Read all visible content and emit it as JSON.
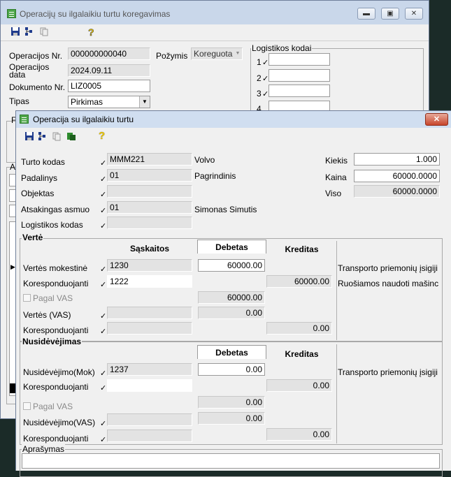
{
  "back": {
    "title": "Operacijų su ilgalaikiu turtu koregavimas",
    "op_nr_label": "Operacijos Nr.",
    "op_nr": "000000000040",
    "op_date_label": "Operacijos data",
    "op_date": "2024.09.11",
    "doc_nr_label": "Dokumento Nr.",
    "doc_nr": "LIZ0005",
    "type_label": "Tipas",
    "type_value": "Pirkimas",
    "pozymis_label": "Požymis",
    "pozymis_value": "Koreguota",
    "logistics_group": "Logistikos kodai",
    "logistics_rows": [
      "1",
      "2",
      "3",
      "4"
    ],
    "frag_f": "F",
    "frag_a": "A"
  },
  "front": {
    "title": "Operacija su ilgalaikiu turtu",
    "help_glyph": "?",
    "asset_code_label": "Turto kodas",
    "asset_code": "MMM221",
    "asset_name": "Volvo",
    "dept_label": "Padalinys",
    "dept_code": "01",
    "dept_name": "Pagrindinis",
    "object_label": "Objektas",
    "object_value": "",
    "responsible_label": "Atsakingas asmuo",
    "responsible_code": "01",
    "responsible_name": "Simonas Simutis",
    "logistics_label": "Logistikos kodas",
    "logistics_value": "",
    "qty_label": "Kiekis",
    "qty": "1.000",
    "price_label": "Kaina",
    "price": "60000.0000",
    "total_label": "Viso",
    "total": "60000.0000",
    "verte": {
      "group": "Vertė",
      "col_accounts": "Sąskaitos",
      "col_debit": "Debetas",
      "col_credit": "Kreditas",
      "rows": [
        {
          "label": "Vertės mokestinė",
          "account": "1230",
          "debit": "60000.00",
          "credit": "",
          "desc": "Transporto priemonių įsigiji"
        },
        {
          "label": "Koresponduojanti",
          "account": "1222",
          "debit": "",
          "credit": "60000.00",
          "desc": "Ruošiamos naudoti mašinc"
        }
      ],
      "pagal_vas_label": "Pagal VAS",
      "pagal_vas_debit": "60000.00",
      "vas_rows": [
        {
          "label": "Vertės (VAS)",
          "account": "",
          "debit": "0.00",
          "credit": ""
        },
        {
          "label": "Koresponduojanti",
          "account": "",
          "debit": "",
          "credit": "0.00"
        }
      ]
    },
    "nusid": {
      "group": "Nusidėvėjimas",
      "col_debit": "Debetas",
      "col_credit": "Kreditas",
      "rows": [
        {
          "label": "Nusidėvėjimo(Mok)",
          "account": "1237",
          "debit": "0.00",
          "credit": "",
          "desc": "Transporto priemonių įsigiji"
        },
        {
          "label": "Koresponduojanti",
          "account": "",
          "debit": "",
          "credit": "0.00",
          "desc": ""
        }
      ],
      "pagal_vas_label": "Pagal VAS",
      "pagal_vas_debit": "0.00",
      "vas_rows": [
        {
          "label": "Nusidėvėjimo(VAS)",
          "account": "",
          "debit": "0.00",
          "credit": ""
        },
        {
          "label": "Koresponduojanti",
          "account": "",
          "debit": "",
          "credit": "0.00"
        }
      ]
    },
    "description_label": "Aprašymas",
    "description_value": ""
  }
}
